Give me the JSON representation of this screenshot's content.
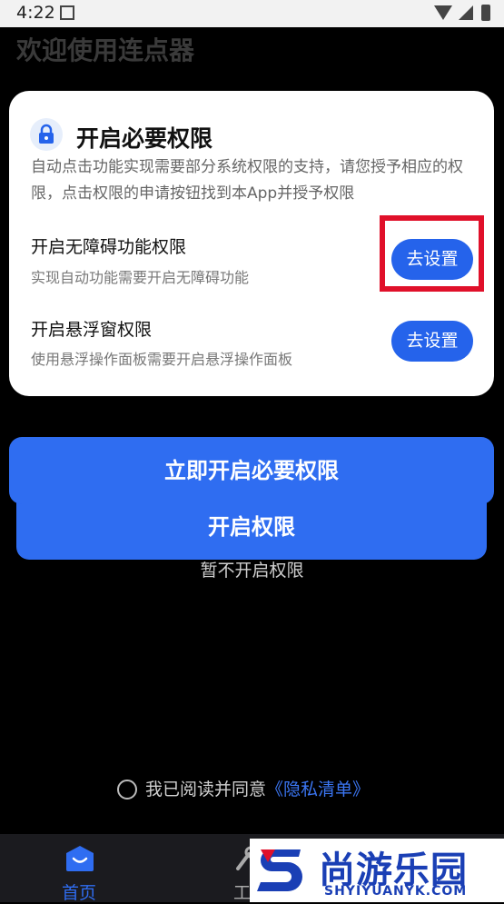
{
  "status_bar": {
    "time": "4:22"
  },
  "page_title": "欢迎使用连点器",
  "card": {
    "title": "开启必要权限",
    "description": "自动点击功能实现需要部分系统权限的支持，请您授予相应的权限，点击权限的申请按钮找到本App并授予权限",
    "permissions": [
      {
        "title": "开启无障碍功能权限",
        "desc": "实现自动功能需要开启无障碍功能",
        "button": "去设置"
      },
      {
        "title": "开启悬浮窗权限",
        "desc": "使用悬浮操作面板需要开启悬浮操作面板",
        "button": "去设置"
      }
    ]
  },
  "primary_button": "立即开启必要权限",
  "secondary_button": "开启权限",
  "skip_link": "暂不开启权限",
  "agreement": {
    "text": "我已阅读并同意",
    "link": "《隐私清单》"
  },
  "bottom_nav": [
    {
      "label": "首页",
      "icon": "home-icon"
    },
    {
      "label": "工",
      "icon": "tool-icon"
    }
  ],
  "watermark": {
    "name": "尚游乐园",
    "url": "SHYIYUANYK.COM"
  },
  "colors": {
    "accent": "#2f6df1",
    "highlight": "#e0102a",
    "background": "#000000"
  }
}
